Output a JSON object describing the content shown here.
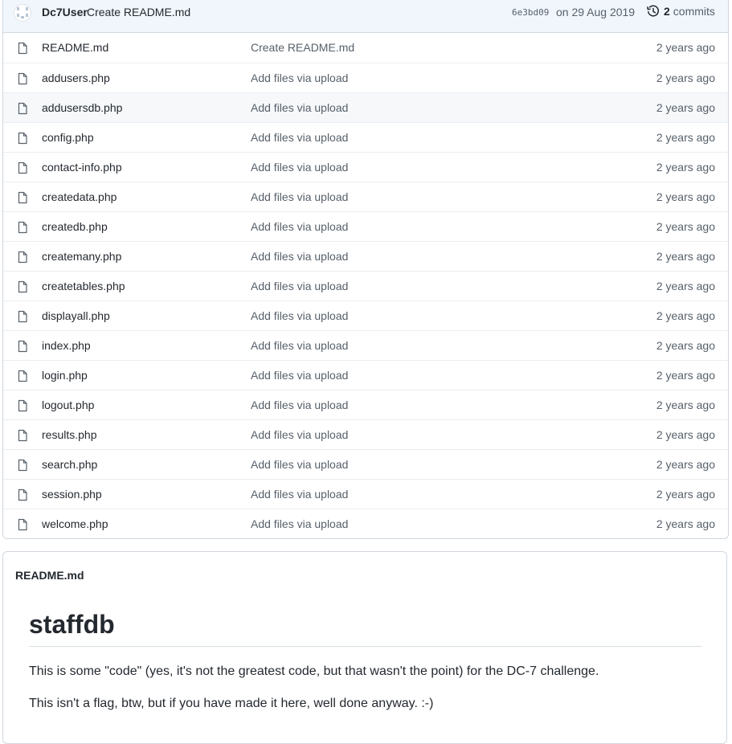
{
  "commit": {
    "user": "Dc7User",
    "message": "Create README.md",
    "sha": "6e3bd09",
    "date": "on 29 Aug 2019",
    "history_icon": "history-icon",
    "commits_count": "2",
    "commits_label": "commits"
  },
  "files": [
    {
      "name": "README.md",
      "message": "Create README.md",
      "age": "2 years ago"
    },
    {
      "name": "addusers.php",
      "message": "Add files via upload",
      "age": "2 years ago"
    },
    {
      "name": "addusersdb.php",
      "message": "Add files via upload",
      "age": "2 years ago"
    },
    {
      "name": "config.php",
      "message": "Add files via upload",
      "age": "2 years ago"
    },
    {
      "name": "contact-info.php",
      "message": "Add files via upload",
      "age": "2 years ago"
    },
    {
      "name": "createdata.php",
      "message": "Add files via upload",
      "age": "2 years ago"
    },
    {
      "name": "createdb.php",
      "message": "Add files via upload",
      "age": "2 years ago"
    },
    {
      "name": "createmany.php",
      "message": "Add files via upload",
      "age": "2 years ago"
    },
    {
      "name": "createtables.php",
      "message": "Add files via upload",
      "age": "2 years ago"
    },
    {
      "name": "displayall.php",
      "message": "Add files via upload",
      "age": "2 years ago"
    },
    {
      "name": "index.php",
      "message": "Add files via upload",
      "age": "2 years ago"
    },
    {
      "name": "login.php",
      "message": "Add files via upload",
      "age": "2 years ago"
    },
    {
      "name": "logout.php",
      "message": "Add files via upload",
      "age": "2 years ago"
    },
    {
      "name": "results.php",
      "message": "Add files via upload",
      "age": "2 years ago"
    },
    {
      "name": "search.php",
      "message": "Add files via upload",
      "age": "2 years ago"
    },
    {
      "name": "session.php",
      "message": "Add files via upload",
      "age": "2 years ago"
    },
    {
      "name": "welcome.php",
      "message": "Add files via upload",
      "age": "2 years ago"
    }
  ],
  "file_icon": "file-icon",
  "readme": {
    "title": "README.md",
    "heading": "staffdb",
    "paragraph1": "This is some \"code\" (yes, it's not the greatest code, but that wasn't the point) for the DC-7 challenge.",
    "paragraph2": "This isn't a flag, btw, but if you have made it here, well done anyway. :-)"
  },
  "colors": {
    "commit_bar_bg": "#f1f6fd",
    "border": "#d0d7de",
    "text": "#24292f",
    "muted": "#57606a"
  }
}
